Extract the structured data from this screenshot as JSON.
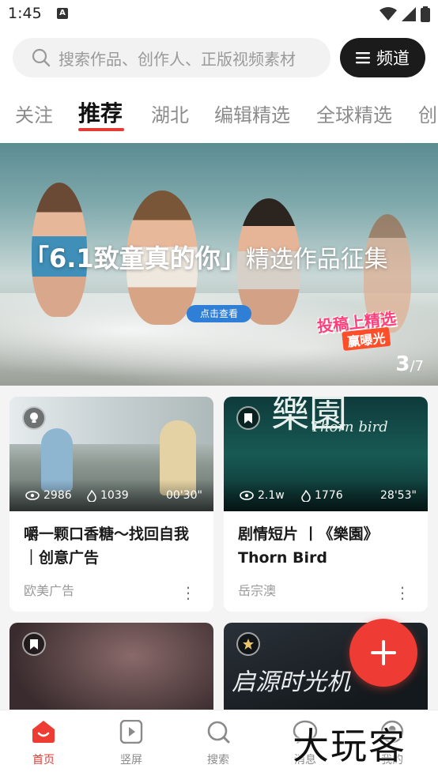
{
  "status_bar": {
    "time": "1:45",
    "notification_letter": "A"
  },
  "search": {
    "placeholder": "搜索作品、创作人、正版视频素材"
  },
  "channel_button": {
    "label": "频道"
  },
  "tabs": [
    {
      "label": "关注"
    },
    {
      "label": "推荐",
      "active": true
    },
    {
      "label": "湖北"
    },
    {
      "label": "编辑精选"
    },
    {
      "label": "全球精选"
    },
    {
      "label": "创"
    }
  ],
  "banner": {
    "title_main": "「6.1致童真的你」",
    "title_sub": "精选作品征集",
    "cta_label": "点击查看",
    "badge_line1": "投稿上精选",
    "badge_line2": "赢曝光",
    "counter_current": "3",
    "counter_total": "/7"
  },
  "feed": {
    "cards": [
      {
        "views": "2986",
        "likes": "1039",
        "duration": "00'30\"",
        "title": "嚼一颗口香糖～找回自我｜创意广告",
        "author": "欧美广告",
        "badge_icon": "lightbulb-icon"
      },
      {
        "views": "2.1w",
        "likes": "1776",
        "duration": "28'53\"",
        "title": "剧情短片 丨《樂園》Thorn Bird",
        "author": "岳宗澳",
        "badge_icon": "bookmark-icon",
        "thumb_text_main": "樂園",
        "thumb_text_sub": "Thorn bird"
      },
      {
        "badge_icon": "bookmark-icon"
      },
      {
        "badge_icon": "star-medal-icon",
        "thumb_text": "启源时光机"
      }
    ]
  },
  "bottom_nav": [
    {
      "label": "首页",
      "icon": "home-icon",
      "active": true
    },
    {
      "label": "竖屏",
      "icon": "vertical-play-icon"
    },
    {
      "label": "搜索",
      "icon": "search-icon"
    },
    {
      "label": "消息",
      "icon": "message-icon"
    },
    {
      "label": "我的",
      "icon": "profile-icon"
    }
  ],
  "watermark": "大玩客",
  "colors": {
    "accent": "#e6372f",
    "dark_button": "#1b1b1b",
    "feed_bg": "#f4f4f5"
  }
}
